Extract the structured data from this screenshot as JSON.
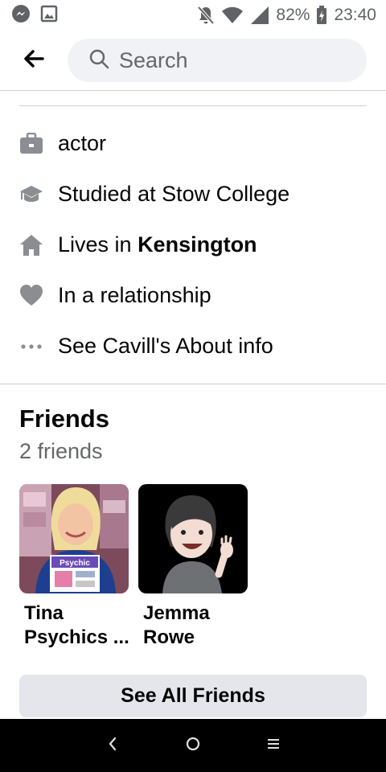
{
  "status_bar": {
    "left_icons": [
      "messenger-icon",
      "image-icon"
    ],
    "right_icons": [
      "mute-icon",
      "wifi-icon",
      "signal-icon",
      "battery-charging-icon"
    ],
    "battery": "82%",
    "time": "23:40"
  },
  "header": {
    "back_icon": "back-arrow-icon",
    "search": {
      "placeholder": "Search",
      "value": ""
    }
  },
  "intro": {
    "items": [
      {
        "icon": "briefcase-icon",
        "text": "actor"
      },
      {
        "icon": "graduation-cap-icon",
        "text": "Studied at Stow College"
      },
      {
        "icon": "home-icon",
        "prefix": "Lives in ",
        "bold": "Kensington"
      },
      {
        "icon": "heart-icon",
        "text": "In a relationship"
      },
      {
        "icon": "more-dots-icon",
        "text": "See Cavill's About info"
      }
    ]
  },
  "friends": {
    "title": "Friends",
    "count": "2 friends",
    "list": [
      {
        "line1": "Tina",
        "line2": "Psychics ...",
        "photo_text": "Psychic"
      },
      {
        "line1": "Jemma",
        "line2": "Rowe"
      }
    ],
    "see_all_label": "See All Friends"
  },
  "nav_bar": {
    "icons": [
      "nav-back-icon",
      "nav-home-icon",
      "nav-recents-icon"
    ]
  },
  "colors": {
    "text": "#050505",
    "secondary": "#65676b",
    "icon": "#8a8d91",
    "button_bg": "#e4e6eb",
    "search_bg": "#f0f2f5"
  }
}
